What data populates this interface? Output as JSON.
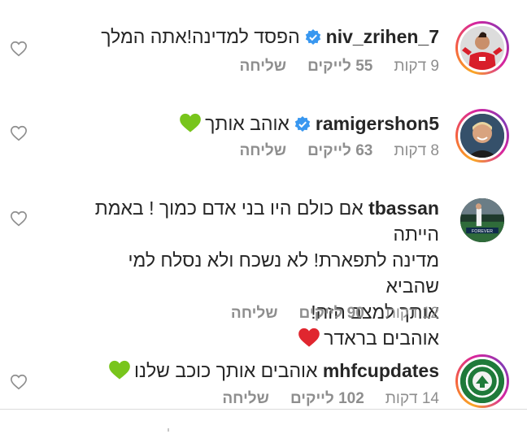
{
  "comments": [
    {
      "username": "niv_zrihen_7",
      "verified": true,
      "text": "הפסד למדינה!אתה המלך",
      "time": "9 דקות",
      "likes": "55 לייקים",
      "reply": "שליחה",
      "avatar_icon": "player-red-jersey-avatar"
    },
    {
      "username": "ramigershon5",
      "verified": true,
      "text": "אוהב אותך",
      "emoji": "green-heart-icon",
      "time": "8 דקות",
      "likes": "63 לייקים",
      "reply": "שליחה",
      "avatar_icon": "smiling-man-avatar"
    },
    {
      "username": "tbassan",
      "verified": false,
      "text_lines": [
        "אם כולם היו בני אדם כמוך ! באמת הייתה",
        "מדינה לתפארת! לא נשכח ולא נסלח למי שהביא",
        "אותך למצב הזה!",
        "אוהבים בראדר"
      ],
      "emoji": "red-heart-icon",
      "time": "12 דקות",
      "likes": "90 לייקים",
      "reply": "שליחה",
      "avatar_icon": "stadium-forever-avatar"
    },
    {
      "username": "mhfcupdates",
      "verified": false,
      "text": "אוהבים אותך כוכב שלנו",
      "emoji": "green-heart-icon",
      "time": "14 דקות",
      "likes": "102 לייקים",
      "reply": "שליחה",
      "avatar_icon": "club-crest-avatar"
    }
  ],
  "colors": {
    "text": "#262626",
    "meta": "#8e8e8e",
    "verified": "#3897f0",
    "green_heart": "#78c51c",
    "red_heart": "#e0262f"
  }
}
